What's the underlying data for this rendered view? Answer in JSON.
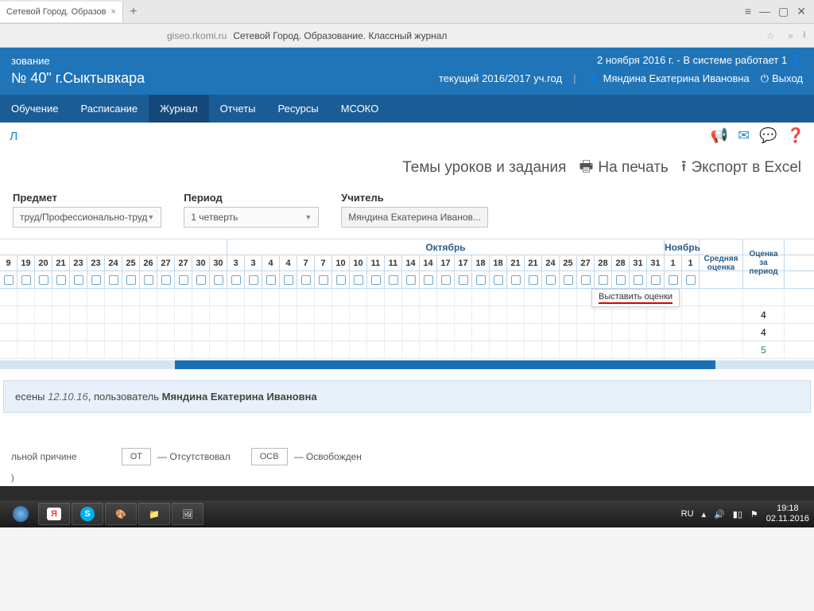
{
  "browser": {
    "tab_title": "Сетевой Город. Образов",
    "host": "giseo.rkomi.ru",
    "page_title": "Сетевой Город. Образование. Классный журнал"
  },
  "header": {
    "line1_left": "зование",
    "line1_right_date": "2 ноября 2016 г.",
    "line1_right_status": "- В системе работает 1",
    "school": "№ 40\" г.Сыктывкара",
    "year": "текущий 2016/2017 уч.год",
    "user": "Мяндина Екатерина Ивановна",
    "logout": "Выход"
  },
  "nav": [
    "Обучение",
    "Расписание",
    "Журнал",
    "Отчеты",
    "Ресурсы",
    "МСОКО"
  ],
  "nav_active_index": 2,
  "page_letter": "л",
  "toolbar": {
    "topics": "Темы уроков и задания",
    "print": "На печать",
    "export": "Экспорт в Excel"
  },
  "filters": {
    "subject_label": "Предмет",
    "subject_value": "труд/Профессионально-труд",
    "period_label": "Период",
    "period_value": "1 четверть",
    "teacher_label": "Учитель",
    "teacher_value": "Мяндина Екатерина Иванов..."
  },
  "months": {
    "october": "Октябрь",
    "november": "Ноябрь"
  },
  "days": [
    "9",
    "19",
    "20",
    "21",
    "23",
    "23",
    "24",
    "25",
    "26",
    "27",
    "27",
    "30",
    "30",
    "3",
    "3",
    "4",
    "4",
    "7",
    "7",
    "10",
    "10",
    "11",
    "11",
    "14",
    "14",
    "17",
    "17",
    "18",
    "18",
    "21",
    "21",
    "24",
    "25",
    "27",
    "28",
    "28",
    "31",
    "31",
    "1",
    "1"
  ],
  "extra_cols": {
    "avg": "Средняя оценка",
    "period": "Оценка за период"
  },
  "tooltip": "Выставить оценки",
  "period_grades": [
    "4",
    "4",
    "5"
  ],
  "info": {
    "prefix": "есены ",
    "date": "12.10.16",
    "mid": ", пользователь ",
    "user": "Мяндина Екатерина Ивановна"
  },
  "legend": {
    "left_text": "льной причине",
    "code1": "ОТ",
    "desc1": "— Отсутствовал",
    "code2": "ОСВ",
    "desc2": "— Освобожден"
  },
  "taskbar": {
    "lang": "RU",
    "time": "19:18",
    "date": "02.11.2016"
  }
}
